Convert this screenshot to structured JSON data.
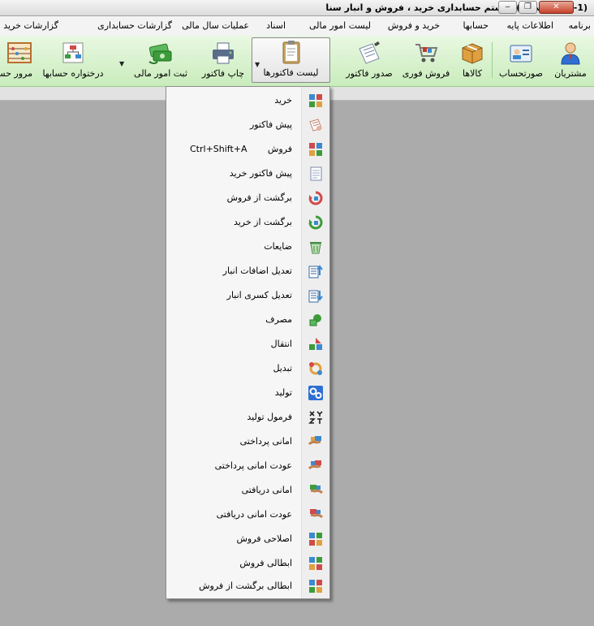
{
  "window": {
    "title": "(1- فراد حساب)سیستم حسابداری خرید ، فروش و انبار سنا",
    "minimize": "‒",
    "restore": "❐",
    "close": "✕"
  },
  "menu": [
    "برنامه",
    "اطلاعات پایه",
    "حسابها",
    "خرید و فروش",
    "لیست امور مالی",
    "اسناد",
    "عملیات سال مالی",
    "گزارشات حسابداری",
    "گزارشات خرید"
  ],
  "toolbar": [
    {
      "label": "مشتریان",
      "icon": "customer-icon",
      "color": "#2f6fd3"
    },
    {
      "label": "صورتحساب",
      "icon": "invoice-card-icon",
      "color": "#3a8ad0"
    },
    {
      "label": "کالاها",
      "icon": "box-icon",
      "color": "#d08a2a"
    },
    {
      "label": "فروش فوری",
      "icon": "cart-icon",
      "color": "#c0392b"
    },
    {
      "label": "صدور فاکتور",
      "icon": "invoice-pen-icon",
      "color": "#7a8aa8"
    },
    {
      "label": "لیست فاکتورها",
      "icon": "clipboard-icon",
      "color": "#c9a464"
    },
    {
      "label": "چاپ فاکتور",
      "icon": "printer-icon",
      "color": "#5a6c8a"
    },
    {
      "label": "ثبت امور مالی",
      "icon": "money-icon",
      "color": "#3c9c3a"
    },
    {
      "label": "درختواره حسابها",
      "icon": "tree-icon",
      "color": "#d04a4a"
    },
    {
      "label": "مرور حسا",
      "icon": "abacus-icon",
      "color": "#b87030"
    }
  ],
  "dropdown": {
    "items": [
      {
        "label": "خرید",
        "icon": "purchase-icon",
        "shortcut": ""
      },
      {
        "label": "پیش فاکتور",
        "icon": "proforma-icon",
        "shortcut": ""
      },
      {
        "label": "فروش",
        "icon": "sale-icon",
        "shortcut": "Ctrl+Shift+A"
      },
      {
        "label": "پیش فاکتور خرید",
        "icon": "purchase-proforma-icon",
        "shortcut": ""
      },
      {
        "label": "برگشت از فروش",
        "icon": "sale-return-icon",
        "shortcut": ""
      },
      {
        "label": "برگشت از خرید",
        "icon": "purchase-return-icon",
        "shortcut": ""
      },
      {
        "label": "ضایعات",
        "icon": "waste-bin-icon",
        "shortcut": ""
      },
      {
        "label": "تعدیل اضافات انبار",
        "icon": "stock-surplus-icon",
        "shortcut": ""
      },
      {
        "label": "تعدیل کسری انبار",
        "icon": "stock-shortage-icon",
        "shortcut": ""
      },
      {
        "label": "مصرف",
        "icon": "consumption-icon",
        "shortcut": ""
      },
      {
        "label": "انتقال",
        "icon": "transfer-icon",
        "shortcut": ""
      },
      {
        "label": "تبدیل",
        "icon": "conversion-icon",
        "shortcut": ""
      },
      {
        "label": "تولید",
        "icon": "production-gears-icon",
        "shortcut": ""
      },
      {
        "label": "فرمول تولید",
        "icon": "formula-icon",
        "shortcut": ""
      },
      {
        "label": "امانی پرداختی",
        "icon": "consignment-out-icon",
        "shortcut": ""
      },
      {
        "label": "عودت امانی پرداختی",
        "icon": "consignment-out-return-icon",
        "shortcut": ""
      },
      {
        "label": "امانی دریافتی",
        "icon": "consignment-in-icon",
        "shortcut": ""
      },
      {
        "label": "عودت امانی دریافتی",
        "icon": "consignment-in-return-icon",
        "shortcut": ""
      },
      {
        "label": "اصلاحی  فروش",
        "icon": "sale-correction-icon",
        "shortcut": ""
      },
      {
        "label": "ابطالی  فروش",
        "icon": "sale-void-icon",
        "shortcut": ""
      },
      {
        "label": "ابطالی برگشت از فروش",
        "icon": "sale-return-void-icon",
        "shortcut": ""
      }
    ]
  }
}
